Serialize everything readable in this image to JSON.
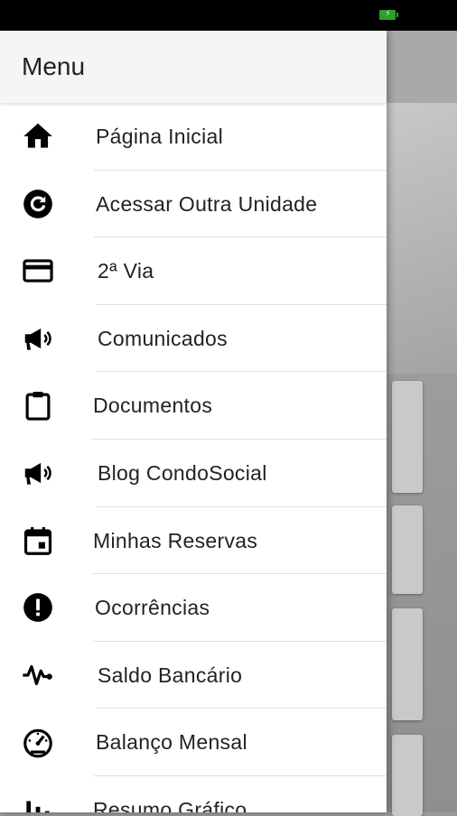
{
  "status_bar": {
    "battery_icon": "battery-charging-icon",
    "battery_color": "#2e9e2e"
  },
  "drawer": {
    "title": "Menu",
    "items": [
      {
        "label": "Página Inicial",
        "icon": "home-icon"
      },
      {
        "label": "Acessar Outra Unidade",
        "icon": "refresh-circle-icon"
      },
      {
        "label": "2ª Via",
        "icon": "credit-card-icon"
      },
      {
        "label": "Comunicados",
        "icon": "megaphone-icon"
      },
      {
        "label": "Documentos",
        "icon": "clipboard-icon"
      },
      {
        "label": "Blog CondoSocial",
        "icon": "megaphone-icon"
      },
      {
        "label": "Minhas Reservas",
        "icon": "calendar-icon"
      },
      {
        "label": "Ocorrências",
        "icon": "alert-circle-icon"
      },
      {
        "label": "Saldo Bancário",
        "icon": "pulse-icon"
      },
      {
        "label": "Balanço Mensal",
        "icon": "speedometer-icon"
      },
      {
        "label": "Resumo Gráfico",
        "icon": "bar-chart-icon"
      }
    ]
  }
}
